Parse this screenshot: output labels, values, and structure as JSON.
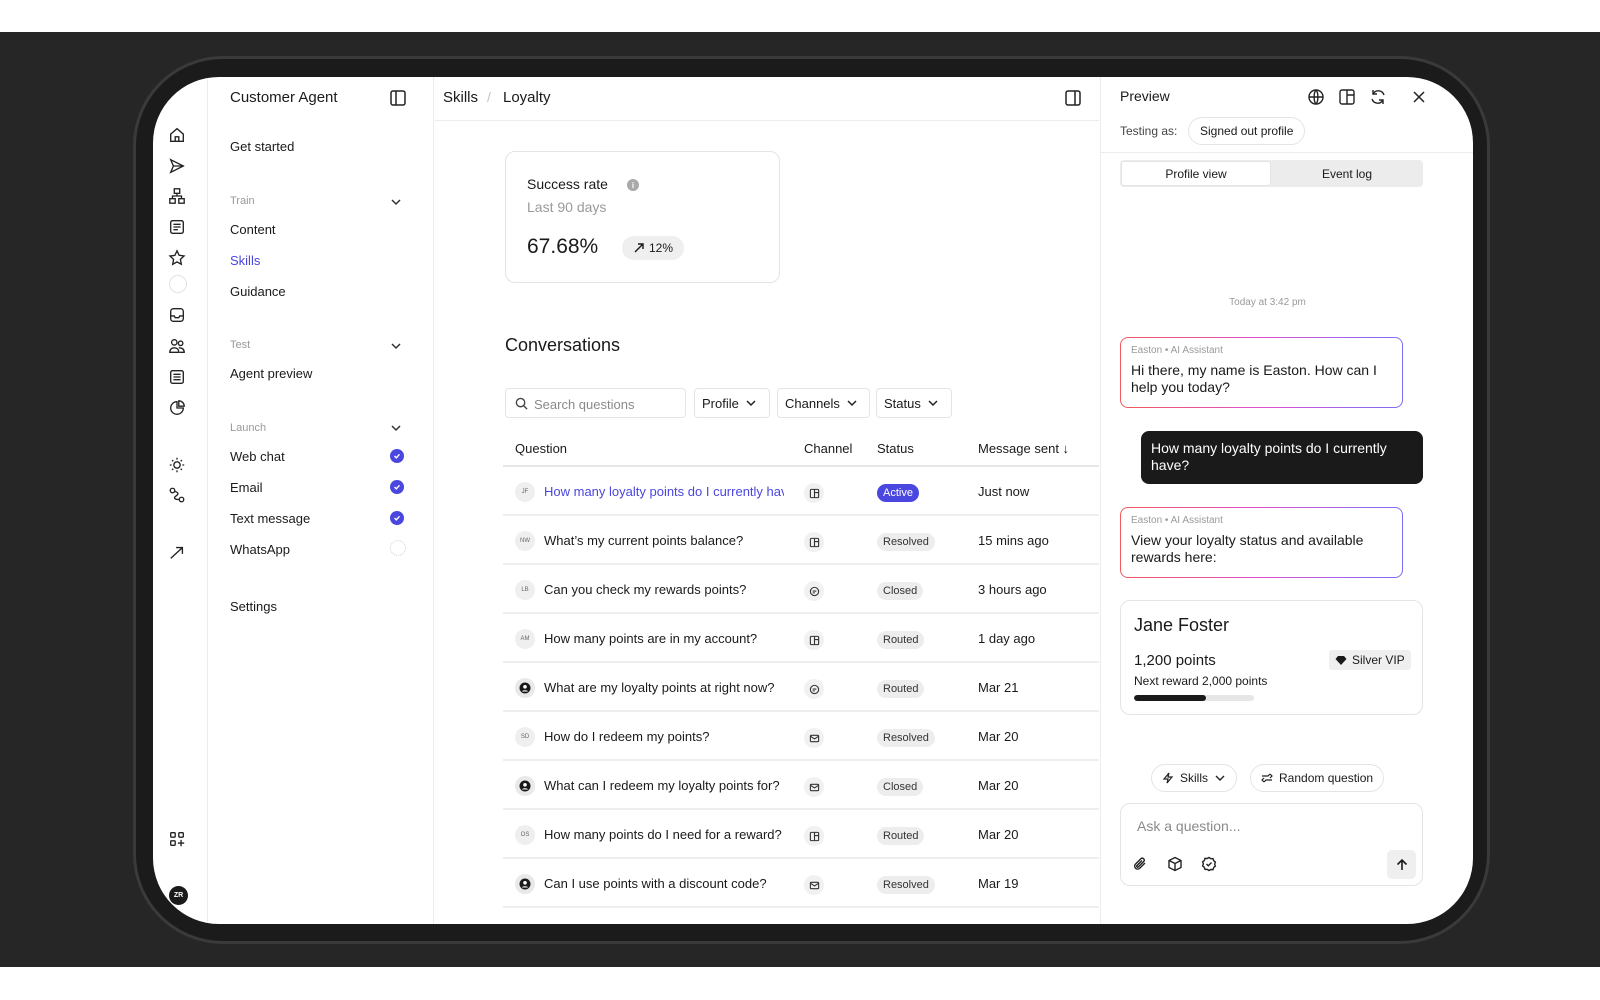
{
  "nav": {
    "title": "Customer Agent",
    "get_started": "Get started",
    "train_label": "Train",
    "train_items": [
      "Content",
      "Skills",
      "Guidance"
    ],
    "test_label": "Test",
    "test_items": [
      "Agent preview"
    ],
    "launch_label": "Launch",
    "launch_items": [
      {
        "label": "Web chat",
        "enabled": true
      },
      {
        "label": "Email",
        "enabled": true
      },
      {
        "label": "Text message",
        "enabled": true
      },
      {
        "label": "WhatsApp",
        "enabled": false
      }
    ],
    "settings": "Settings",
    "active_item": "Skills"
  },
  "rail": {
    "avatar_initials": "ZR"
  },
  "header": {
    "crumbs": [
      "Skills",
      "Loyalty"
    ]
  },
  "metric": {
    "title": "Success rate",
    "period": "Last 90 days",
    "value": "67.68%",
    "trend": "12%"
  },
  "conversations": {
    "title": "Conversations",
    "search_placeholder": "Search questions",
    "filters": [
      "Profile",
      "Channels",
      "Status"
    ],
    "columns": [
      "Question",
      "Channel",
      "Status",
      "Message sent ↓"
    ],
    "rows": [
      {
        "initials": "JF",
        "question": "How many loyalty points do I currently have?",
        "channel": "web",
        "status": "Active",
        "sent": "Just now"
      },
      {
        "initials": "NW",
        "question": "What’s my current points balance?",
        "channel": "web",
        "status": "Resolved",
        "sent": "15 mins ago"
      },
      {
        "initials": "LB",
        "question": "Can you check my rewards points?",
        "channel": "sms",
        "status": "Closed",
        "sent": "3 hours ago"
      },
      {
        "initials": "AM",
        "question": "How many points are in my account?",
        "channel": "web",
        "status": "Routed",
        "sent": "1 day ago"
      },
      {
        "initials": "",
        "question": "What are my loyalty points at right now?",
        "channel": "sms",
        "status": "Routed",
        "sent": "Mar 21"
      },
      {
        "initials": "SD",
        "question": "How do I redeem my points?",
        "channel": "email",
        "status": "Resolved",
        "sent": "Mar 20"
      },
      {
        "initials": "",
        "question": "What can I redeem my loyalty points for?",
        "channel": "email",
        "status": "Closed",
        "sent": "Mar 20"
      },
      {
        "initials": "OS",
        "question": "How many points do I need for a reward?",
        "channel": "web",
        "status": "Routed",
        "sent": "Mar 20"
      },
      {
        "initials": "",
        "question": "Can I use points with a discount code?",
        "channel": "email",
        "status": "Resolved",
        "sent": "Mar 19"
      }
    ]
  },
  "preview": {
    "title": "Preview",
    "testing_label": "Testing as:",
    "profile": "Signed out profile",
    "tabs": [
      "Profile view",
      "Event log"
    ],
    "timestamp": "Today at 3:42 pm",
    "assistant_meta": "Easton • AI Assistant",
    "msg1": "Hi there, my name is Easton. How can I help you today?",
    "user_msg": "How many loyalty points do I currently have?",
    "msg2": "View your loyalty status and available rewards here:",
    "card": {
      "name": "Jane Foster",
      "points": "1,200 points",
      "tier": "Silver VIP",
      "next": "Next reward 2,000 points",
      "progress": 0.6
    },
    "chips": [
      "Skills",
      "Random question"
    ],
    "input_placeholder": "Ask a question..."
  },
  "colors": {
    "accent": "#4a46e0",
    "dark": "#1a1a1a"
  }
}
